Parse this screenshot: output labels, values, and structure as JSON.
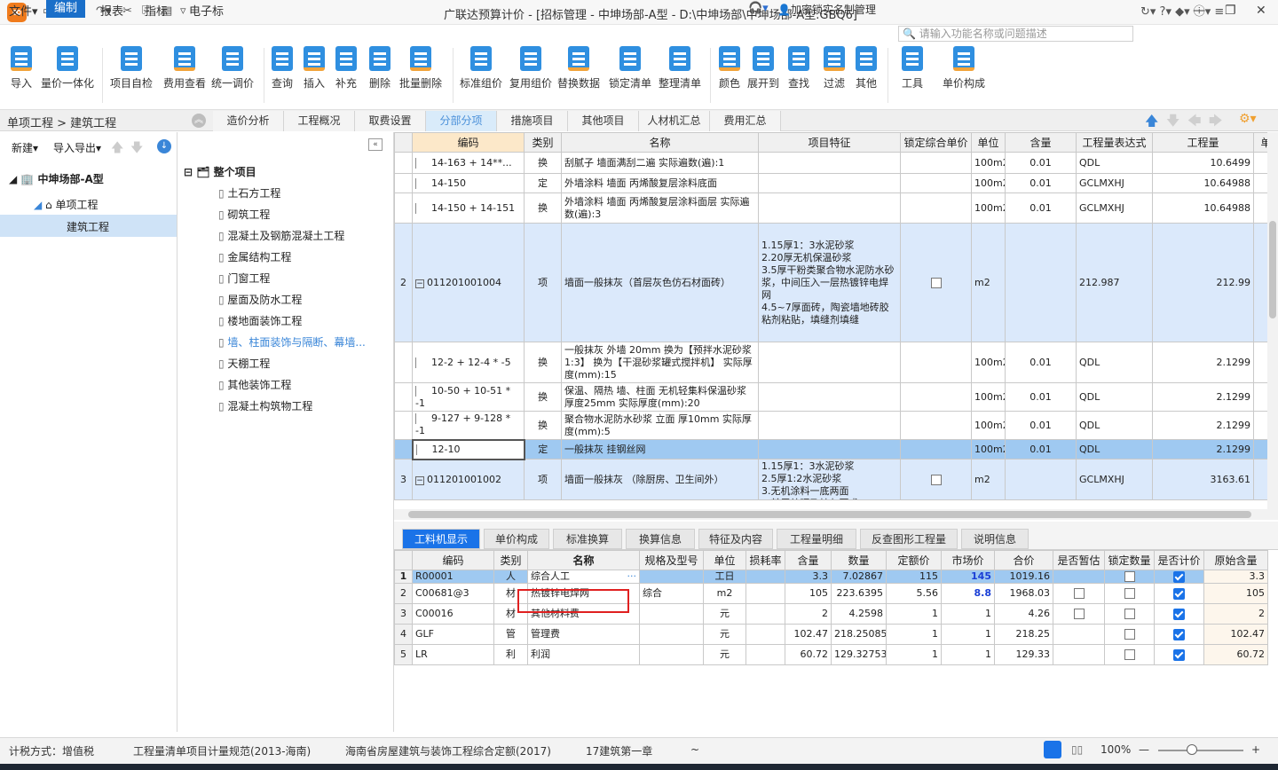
{
  "title": {
    "window": "广联达预算计价 - [招标管理 - 中坤场部-A型 - D:\\中坤场部\\中坤场部-A型.GBQ6]"
  },
  "menu": {
    "file": "文件▾",
    "edit": "编制",
    "report": "报表",
    "index": "指标",
    "etender": "电子标",
    "login": "加密锁实名制管理",
    "search_placeholder": "请输入功能名称或问题描述"
  },
  "toolbar": [
    "导入",
    "量价一体化",
    "项目自检",
    "费用查看",
    "统一调价",
    "查询",
    "插入",
    "补充",
    "删除",
    "批量删除",
    "标准组价",
    "复用组价",
    "替换数据",
    "锁定清单",
    "整理清单",
    "颜色",
    "展开到",
    "查找",
    "过滤",
    "其他",
    "工具",
    "单价构成"
  ],
  "breadcrumb": "单项工程 > 建筑工程",
  "tabs": [
    "造价分析",
    "工程概况",
    "取费设置",
    "分部分项",
    "措施项目",
    "其他项目",
    "人材机汇总",
    "费用汇总"
  ],
  "left": {
    "new": "新建▾",
    "io": "导入导出▾",
    "root": "中坤场部-A型",
    "single": "单项工程",
    "building": "建筑工程"
  },
  "mid": {
    "root": "整个项目",
    "items": [
      "土石方工程",
      "砌筑工程",
      "混凝土及钢筋混凝土工程",
      "金属结构工程",
      "门窗工程",
      "屋面及防水工程",
      "楼地面装饰工程",
      "墙、柱面装饰与隔断、幕墙...",
      "天棚工程",
      "其他装饰工程",
      "混凝土构筑物工程"
    ]
  },
  "main": {
    "headers": [
      "",
      "编码",
      "类别",
      "名称",
      "项目特征",
      "锁定综合单价",
      "单位",
      "含量",
      "工程量表达式",
      "工程量",
      "单"
    ],
    "rows": [
      {
        "no": "",
        "code": "14-163 + 14**...",
        "type": "换",
        "name": "刮腻子 墙面满刮二遍  实际遍数(遍):1",
        "feat": "",
        "unit": "100m2",
        "qty": "0.01",
        "expr": "QDL",
        "amt": "10.6499",
        "p": ""
      },
      {
        "no": "",
        "code": "14-150",
        "type": "定",
        "name": "外墙涂料 墙面 丙烯酸复层涂料底面",
        "feat": "",
        "unit": "100m2",
        "qty": "0.01",
        "expr": "GCLMXHJ",
        "amt": "10.64988",
        "p": "4"
      },
      {
        "no": "",
        "code": "14-150 + 14-151",
        "type": "换",
        "name": "外墙涂料 墙面 丙烯酸复层涂料面层  实际遍数(遍):3",
        "feat": "",
        "unit": "100m2",
        "qty": "0.01",
        "expr": "GCLMXHJ",
        "amt": "10.64988",
        "p": "4"
      },
      {
        "no": "2",
        "code": "011201001004",
        "type": "项",
        "name": "墙面一般抹灰（首层灰色仿石材面砖）",
        "feat": "1.15厚1：3水泥砂浆\n2.20厚无机保温砂浆\n3.5厚干粉类聚合物水泥防水砂浆，中间压入一层热镀锌电焊网\n4.5~7厚面砖，陶瓷墙地砖胶粘剂粘贴，填缝剂填缝",
        "unit": "m2",
        "qty": "",
        "expr": "212.987",
        "amt": "212.99",
        "p": ""
      },
      {
        "no": "",
        "code": "12-2 + 12-4 * -5",
        "type": "换",
        "name": "一般抹灰 外墙 20mm  换为【预拌水泥砂浆1:3】  换为【干混砂浆罐式搅拌机】  实际厚度(mm):15",
        "feat": "",
        "unit": "100m2",
        "qty": "0.01",
        "expr": "QDL",
        "amt": "2.1299",
        "p": "4"
      },
      {
        "no": "",
        "code": "10-50 + 10-51 * -1",
        "type": "换",
        "name": "保温、隔热 墙、柱面 无机轻集料保温砂浆 厚度25mm  实际厚度(mm):20",
        "feat": "",
        "unit": "100m2",
        "qty": "0.01",
        "expr": "QDL",
        "amt": "2.1299",
        "p": "4"
      },
      {
        "no": "",
        "code": "9-127 + 9-128 * -1",
        "type": "换",
        "name": "聚合物水泥防水砂浆 立面 厚10mm  实际厚度(mm):5",
        "feat": "",
        "unit": "100m2",
        "qty": "0.01",
        "expr": "QDL",
        "amt": "2.1299",
        "p": "4"
      },
      {
        "no": "",
        "code": "12-10",
        "type": "定",
        "name": "一般抹灰 挂钢丝网",
        "feat": "",
        "unit": "100m2",
        "qty": "0.01",
        "expr": "QDL",
        "amt": "2.1299",
        "p": "1"
      },
      {
        "no": "3",
        "code": "011201001002",
        "type": "项",
        "name": "墙面一般抹灰 （除厨房、卫生间外）",
        "feat": "1.15厚1：3水泥砂浆\n2.5厚1:2水泥砂浆\n3.无机涂料一底两面\n4.基层处理及抹灰要求",
        "unit": "m2",
        "qty": "",
        "expr": "GCLMXHJ",
        "amt": "3163.61",
        "p": ""
      }
    ]
  },
  "bottom": {
    "tabs": [
      "工料机显示",
      "单价构成",
      "标准换算",
      "换算信息",
      "特征及内容",
      "工程量明细",
      "反查图形工程量",
      "说明信息"
    ],
    "headers": [
      "",
      "编码",
      "类别",
      "名称",
      "规格及型号",
      "单位",
      "损耗率",
      "含量",
      "数量",
      "定额价",
      "市场价",
      "合价",
      "是否暂估",
      "锁定数量",
      "是否计价",
      "原始含量"
    ],
    "rows": [
      {
        "no": "1",
        "code": "R00001",
        "type": "人",
        "name": "综合人工",
        "spec": "",
        "unit": "工日",
        "loss": "",
        "qty": "3.3",
        "num": "7.02867",
        "dp": "115",
        "mp": "145",
        "total": "1019.16",
        "est": false,
        "orig": "3.3"
      },
      {
        "no": "2",
        "code": "C00681@3",
        "type": "材",
        "name": "热镀锌电焊网",
        "spec": "综合",
        "unit": "m2",
        "loss": "",
        "qty": "105",
        "num": "223.6395",
        "dp": "5.56",
        "mp": "8.8",
        "total": "1968.03",
        "est": true,
        "orig": "105"
      },
      {
        "no": "3",
        "code": "C00016",
        "type": "材",
        "name": "其他材料费",
        "spec": "",
        "unit": "元",
        "loss": "",
        "qty": "2",
        "num": "4.2598",
        "dp": "1",
        "mp": "1",
        "total": "4.26",
        "est": true,
        "orig": "2"
      },
      {
        "no": "4",
        "code": "GLF",
        "type": "管",
        "name": "管理费",
        "spec": "",
        "unit": "元",
        "loss": "",
        "qty": "102.47",
        "num": "218.25085",
        "dp": "1",
        "mp": "1",
        "total": "218.25",
        "est": false,
        "orig": "102.47"
      },
      {
        "no": "5",
        "code": "LR",
        "type": "利",
        "name": "利润",
        "spec": "",
        "unit": "元",
        "loss": "",
        "qty": "60.72",
        "num": "129.32753",
        "dp": "1",
        "mp": "1",
        "total": "129.33",
        "est": false,
        "orig": "60.72"
      }
    ]
  },
  "status": {
    "tax": "计税方式：增值税",
    "norm": "工程量清单项目计量规范(2013-海南)",
    "quota": "海南省房屋建筑与装饰工程综合定额(2017)",
    "chapter": "17建筑第一章",
    "tilde": "~",
    "zoom": "100%"
  }
}
